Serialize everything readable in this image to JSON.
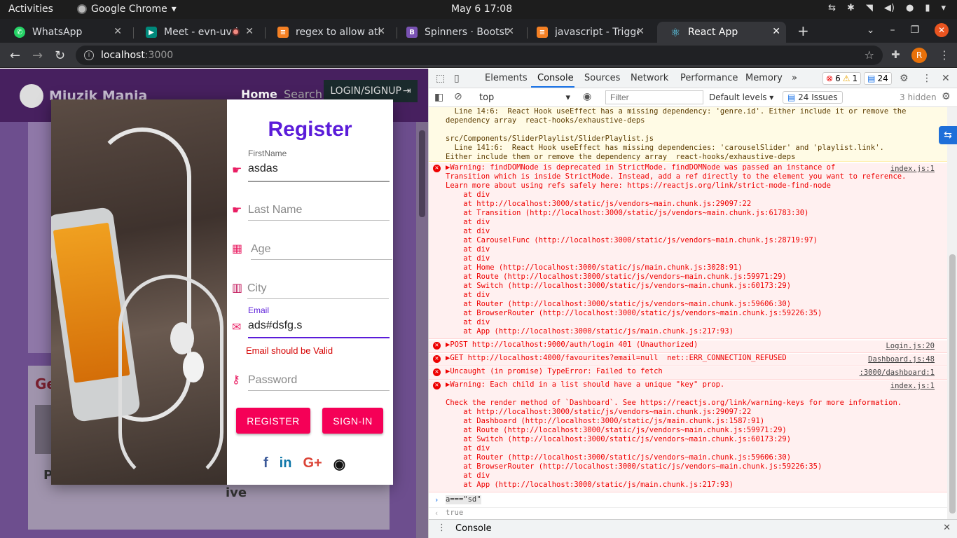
{
  "topbar": {
    "activities": "Activities",
    "app_name": "Google Chrome",
    "clock": "May 6  17:08"
  },
  "tabs": [
    {
      "title": "WhatsApp",
      "icon": "whatsapp-icon",
      "color": "#25d366"
    },
    {
      "title": "Meet - evn-uvd",
      "icon": "meet-icon",
      "color": "#00897b"
    },
    {
      "title": "regex to allow atle",
      "icon": "stackoverflow-icon",
      "color": "#f48024"
    },
    {
      "title": "Spinners · Bootstr",
      "icon": "bootstrap-icon",
      "color": "#7952b3"
    },
    {
      "title": "javascript - Trigge",
      "icon": "stackoverflow-icon",
      "color": "#f48024"
    },
    {
      "title": "React App",
      "icon": "react-icon",
      "color": "#61dafb"
    }
  ],
  "omnibox": {
    "host": "localhost",
    "port": ":3000"
  },
  "profile_initial": "R",
  "site": {
    "name": "Miuzik Mania",
    "nav_home": "Home",
    "nav_search": "Search",
    "nav_login": "LOGIN/SIGNUP",
    "bg_heading": "Ge",
    "bg_text1": "P",
    "bg_text2": "ive"
  },
  "register": {
    "title": "Register",
    "firstname_label": "FirstName",
    "firstname_value": "asdas",
    "lastname_placeholder": "Last Name",
    "age_placeholder": "Age",
    "city_placeholder": "City",
    "email_label": "Email",
    "email_value": "ads#dsfg.s",
    "email_error": "Email should be Valid",
    "password_placeholder": "Password",
    "register_button": "REGISTER",
    "signin_button": "SIGN-IN",
    "social": {
      "facebook": "f",
      "linkedin": "in",
      "google": "G+",
      "github": "◉"
    }
  },
  "devtools": {
    "tabs": [
      "Elements",
      "Console",
      "Sources",
      "Network",
      "Performance",
      "Memory"
    ],
    "active_tab": "Console",
    "more": "»",
    "error_count": "6",
    "warn_count": "1",
    "msg_count": "24",
    "context": "top",
    "filter_placeholder": "Filter",
    "levels": "Default levels",
    "issues": "24 Issues",
    "hidden": "3 hidden",
    "drawer_tab": "Console",
    "warning_text": "  Line 14:6:  React Hook useEffect has a missing dependency: 'genre.id'. Either include it or remove the\ndependency array  react-hooks/exhaustive-deps\n\nsrc/Components/SliderPlaylist/SliderPlaylist.js\n  Line 141:6:  React Hook useEffect has missing dependencies: 'carouselSlider' and 'playlist.link'.\nEither include them or remove the dependency array  react-hooks/exhaustive-deps",
    "messages": [
      {
        "src": "index.js:1",
        "text": "▶Warning: findDOMNode is deprecated in StrictMode. findDOMNode was passed an instance of\nTransition which is inside StrictMode. Instead, add a ref directly to the element you want to reference.\nLearn more about using refs safely here: https://reactjs.org/link/strict-mode-find-node\n    at div\n    at http://localhost:3000/static/js/vendors~main.chunk.js:29097:22\n    at Transition (http://localhost:3000/static/js/vendors~main.chunk.js:61783:30)\n    at div\n    at div\n    at CarouselFunc (http://localhost:3000/static/js/vendors~main.chunk.js:28719:97)\n    at div\n    at div\n    at Home (http://localhost:3000/static/js/main.chunk.js:3028:91)\n    at Route (http://localhost:3000/static/js/vendors~main.chunk.js:59971:29)\n    at Switch (http://localhost:3000/static/js/vendors~main.chunk.js:60173:29)\n    at div\n    at Router (http://localhost:3000/static/js/vendors~main.chunk.js:59606:30)\n    at BrowserRouter (http://localhost:3000/static/js/vendors~main.chunk.js:59226:35)\n    at div\n    at App (http://localhost:3000/static/js/main.chunk.js:217:93)"
      },
      {
        "src": "Login.js:20",
        "text": "▶POST http://localhost:9000/auth/login 401 (Unauthorized)"
      },
      {
        "src": "Dashboard.js:48",
        "text": "▶GET http://localhost:4000/favourites?email=null  net::ERR_CONNECTION_REFUSED"
      },
      {
        "src": ":3000/dashboard:1",
        "text": "▶Uncaught (in promise) TypeError: Failed to fetch"
      },
      {
        "src": "index.js:1",
        "text": "▶Warning: Each child in a list should have a unique \"key\" prop.\n\nCheck the render method of `Dashboard`. See https://reactjs.org/link/warning-keys for more information.\n    at http://localhost:3000/static/js/vendors~main.chunk.js:29097:22\n    at Dashboard (http://localhost:3000/static/js/main.chunk.js:1587:91)\n    at Route (http://localhost:3000/static/js/vendors~main.chunk.js:59971:29)\n    at Switch (http://localhost:3000/static/js/vendors~main.chunk.js:60173:29)\n    at div\n    at Router (http://localhost:3000/static/js/vendors~main.chunk.js:59606:30)\n    at BrowserRouter (http://localhost:3000/static/js/vendors~main.chunk.js:59226:35)\n    at div\n    at App (http://localhost:3000/static/js/main.chunk.js:217:93)"
      }
    ],
    "prompt_input": "a===\"sd\"",
    "prompt_result": "true"
  }
}
